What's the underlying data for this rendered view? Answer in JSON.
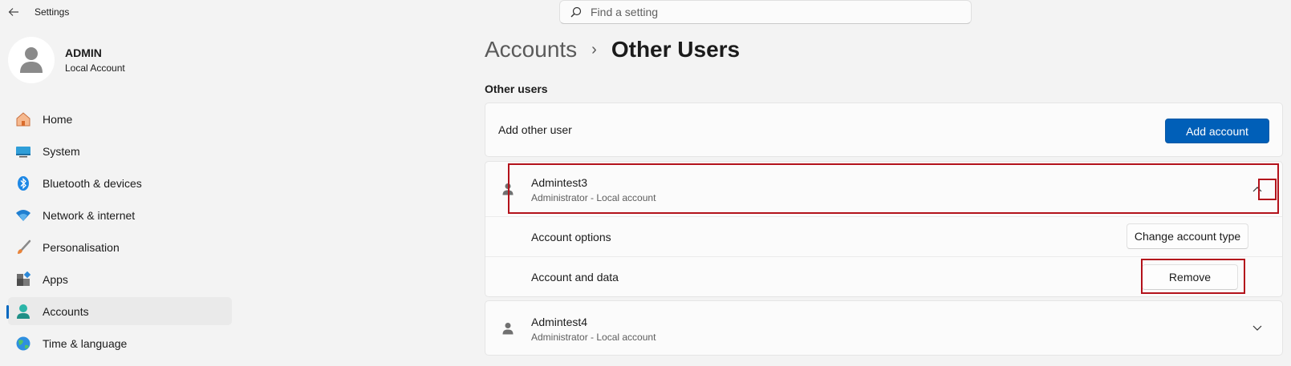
{
  "window": {
    "title": "Settings",
    "back_icon": "back-arrow-icon"
  },
  "search": {
    "placeholder": "Find a setting",
    "value": ""
  },
  "profile": {
    "name": "ADMIN",
    "account_type": "Local Account"
  },
  "sidebar": {
    "items": [
      {
        "label": "Home",
        "icon": "home-icon",
        "active": false
      },
      {
        "label": "System",
        "icon": "system-icon",
        "active": false
      },
      {
        "label": "Bluetooth & devices",
        "icon": "bluetooth-icon",
        "active": false
      },
      {
        "label": "Network & internet",
        "icon": "wifi-icon",
        "active": false
      },
      {
        "label": "Personalisation",
        "icon": "brush-icon",
        "active": false
      },
      {
        "label": "Apps",
        "icon": "apps-icon",
        "active": false
      },
      {
        "label": "Accounts",
        "icon": "accounts-icon",
        "active": true
      },
      {
        "label": "Time & language",
        "icon": "globe-icon",
        "active": false
      }
    ]
  },
  "breadcrumb": {
    "parent": "Accounts",
    "separator": "›",
    "current": "Other Users"
  },
  "main": {
    "section_title": "Other users",
    "add_row": {
      "label": "Add other user",
      "button": "Add account"
    },
    "users": [
      {
        "name": "Admintest3",
        "role": "Administrator - Local account",
        "expanded": true,
        "options": [
          {
            "label": "Account options",
            "button": "Change account type"
          },
          {
            "label": "Account and data",
            "button": "Remove"
          }
        ]
      },
      {
        "name": "Admintest4",
        "role": "Administrator - Local account",
        "expanded": false
      }
    ]
  },
  "colors": {
    "accent": "#005fb8",
    "highlight": "#b3121b",
    "background": "#f3f3f3"
  }
}
